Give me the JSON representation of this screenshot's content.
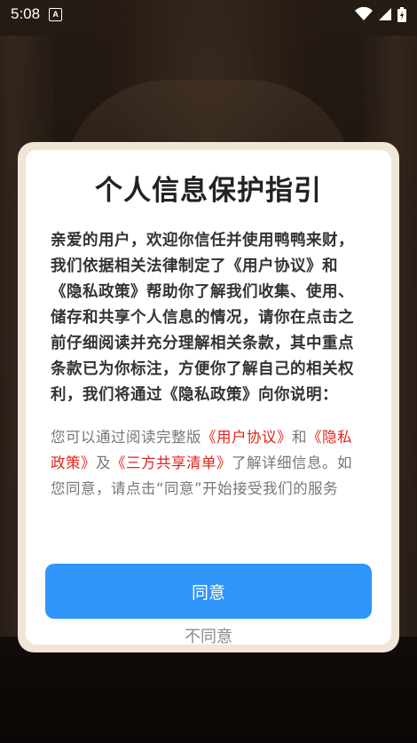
{
  "status_bar": {
    "time": "5:08",
    "notification_letter": "A",
    "icons": [
      "wifi-icon",
      "signal-icon",
      "battery-icon"
    ]
  },
  "dialog": {
    "title": "个人信息保护指引",
    "intro": "亲爱的用户，欢迎你信任并使用鸭鸭来财，我们依据相关法律制定了《用户协议》和《隐私政策》帮助你了解我们收集、使用、储存和共享个人信息的情况，请你在点击之前仔细阅读并充分理解相关条款，其中重点条款已为你标注，方便你了解自己的相关权利，我们将通过《隐私政策》向你说明：",
    "notice": {
      "part1": "您可以通过阅读完整版",
      "link_user_agreement": "《用户协议》",
      "part2": "和",
      "link_privacy_policy": "《隐私政策》",
      "part3": "及",
      "link_third_party_list": "《三方共享清单》",
      "part4": "了解详细信息。如您同意，请点击“同意”开始接受我们的服务"
    },
    "agree_label": "同意",
    "disagree_label": "不同意"
  },
  "colors": {
    "primary_button": "#2f95f9",
    "link": "#e2241c",
    "frame": "#f1e6d6"
  }
}
